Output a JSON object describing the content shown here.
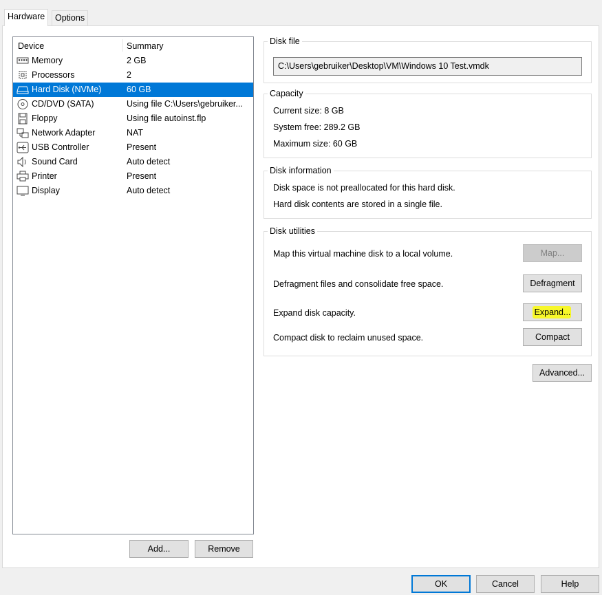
{
  "tabs": [
    {
      "label": "Hardware",
      "active": true
    },
    {
      "label": "Options",
      "active": false
    }
  ],
  "device_list": {
    "columns": [
      "Device",
      "Summary"
    ],
    "rows": [
      {
        "icon": "memory-icon",
        "device": "Memory",
        "summary": "2 GB",
        "selected": false
      },
      {
        "icon": "processor-icon",
        "device": "Processors",
        "summary": "2",
        "selected": false
      },
      {
        "icon": "hard-disk-icon",
        "device": "Hard Disk (NVMe)",
        "summary": "60 GB",
        "selected": true
      },
      {
        "icon": "cd-dvd-icon",
        "device": "CD/DVD (SATA)",
        "summary": "Using file C:\\Users\\gebruiker...",
        "selected": false
      },
      {
        "icon": "floppy-icon",
        "device": "Floppy",
        "summary": "Using file autoinst.flp",
        "selected": false
      },
      {
        "icon": "network-adapter-icon",
        "device": "Network Adapter",
        "summary": "NAT",
        "selected": false
      },
      {
        "icon": "usb-icon",
        "device": "USB Controller",
        "summary": "Present",
        "selected": false
      },
      {
        "icon": "sound-card-icon",
        "device": "Sound Card",
        "summary": "Auto detect",
        "selected": false
      },
      {
        "icon": "printer-icon",
        "device": "Printer",
        "summary": "Present",
        "selected": false
      },
      {
        "icon": "display-icon",
        "device": "Display",
        "summary": "Auto detect",
        "selected": false
      }
    ]
  },
  "list_buttons": {
    "add": "Add...",
    "remove": "Remove"
  },
  "disk_file": {
    "title": "Disk file",
    "value": "C:\\Users\\gebruiker\\Desktop\\VM\\Windows 10 Test.vmdk"
  },
  "capacity": {
    "title": "Capacity",
    "current": "Current size: 8 GB",
    "system_free": "System free: 289.2 GB",
    "maximum": "Maximum size: 60 GB"
  },
  "disk_information": {
    "title": "Disk information",
    "line1": "Disk space is not preallocated for this hard disk.",
    "line2": "Hard disk contents are stored in a single file."
  },
  "disk_utilities": {
    "title": "Disk utilities",
    "map_text": "Map this virtual machine disk to a local volume.",
    "map_button": "Map...",
    "defrag_text": "Defragment files and consolidate free space.",
    "defrag_button": "Defragment",
    "expand_text": "Expand disk capacity.",
    "expand_button": "Expand...",
    "compact_text": "Compact disk to reclaim unused space.",
    "compact_button": "Compact"
  },
  "advanced_button": "Advanced...",
  "dialog_buttons": {
    "ok": "OK",
    "cancel": "Cancel",
    "help": "Help"
  },
  "colors": {
    "selection": "#0078d7",
    "highlight": "#f7f72a"
  }
}
